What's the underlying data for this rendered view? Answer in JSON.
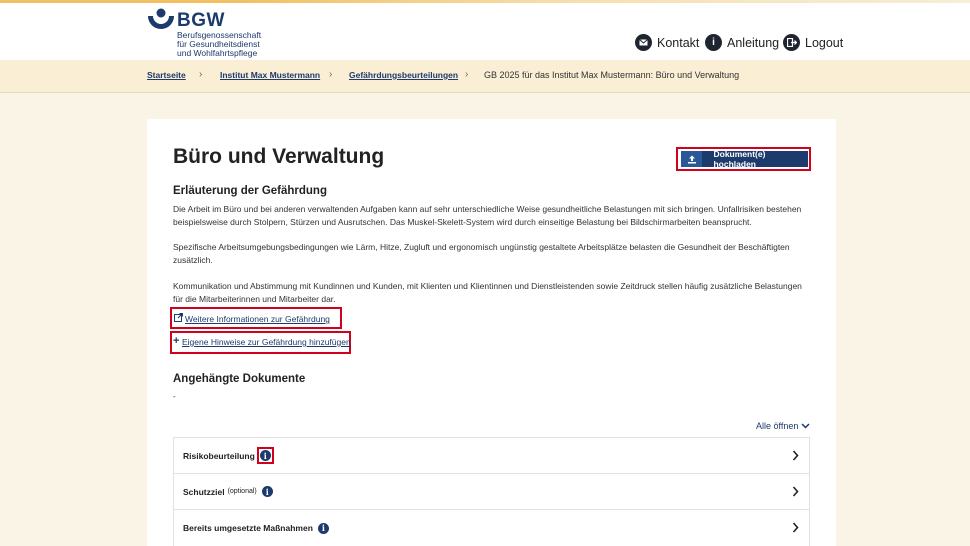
{
  "header": {
    "logo_name": "BGW",
    "logo_subtitle_lines": [
      "Berufsgenossenschaft",
      "für Gesundheitsdienst",
      "und Wohlfahrtspflege"
    ],
    "nav": [
      {
        "label": "Kontakt",
        "icon": "mail-icon"
      },
      {
        "label": "Anleitung",
        "icon": "info-icon"
      },
      {
        "label": "Logout",
        "icon": "logout-icon"
      }
    ]
  },
  "breadcrumb": {
    "items": [
      "Startseite",
      "Institut Max Mustermann",
      "Gefährdungsbeurteilungen"
    ],
    "current": "GB 2025 für das Institut Max Mustermann: Büro und Verwaltung"
  },
  "main": {
    "title": "Büro und Verwaltung",
    "upload_label": "Dokument(e) hochladen",
    "explanation_heading": "Erläuterung der Gefährdung",
    "paragraphs": [
      "Die Arbeit im Büro und bei anderen verwaltenden Aufgaben kann auf sehr unterschiedliche Weise gesundheitliche Belastungen mit sich bringen. Unfallrisiken bestehen beispielsweise durch Stolpern, Stürzen und Ausrutschen. Das Muskel-Skelett-System wird durch einseitige Belastung bei Bildschirmarbeiten beansprucht.",
      "Spezifische Arbeitsumgebungsbedingungen wie Lärm, Hitze, Zugluft und ergonomisch ungünstig gestaltete Arbeitsplätze belasten die Gesundheit der Beschäftigten zusätzlich.",
      "Kommunikation und Abstimmung mit Kundinnen und Kunden, mit Klienten und Klientinnen und Dienstleistenden sowie Zeitdruck stellen häufig zusätzliche Belastungen für die Mitarbeiterinnen und Mitarbeiter dar."
    ],
    "more_info_link": "Weitere Informationen zur Gefährdung",
    "add_notes_link": "Eigene Hinweise zur Gefährdung hinzufügen",
    "attached_heading": "Angehängte Dokumente",
    "attached_placeholder": "-",
    "expand_all": "Alle öffnen",
    "accordion": [
      {
        "label": "Risikobeurteilung",
        "optional": ""
      },
      {
        "label": "Schutzziel",
        "optional": "(optional)"
      },
      {
        "label": "Bereits umgesetzte Maßnahmen",
        "optional": ""
      }
    ]
  },
  "colors": {
    "brand": "#1c3a6b",
    "highlight": "#d0021b",
    "background": "#faf4e6"
  }
}
